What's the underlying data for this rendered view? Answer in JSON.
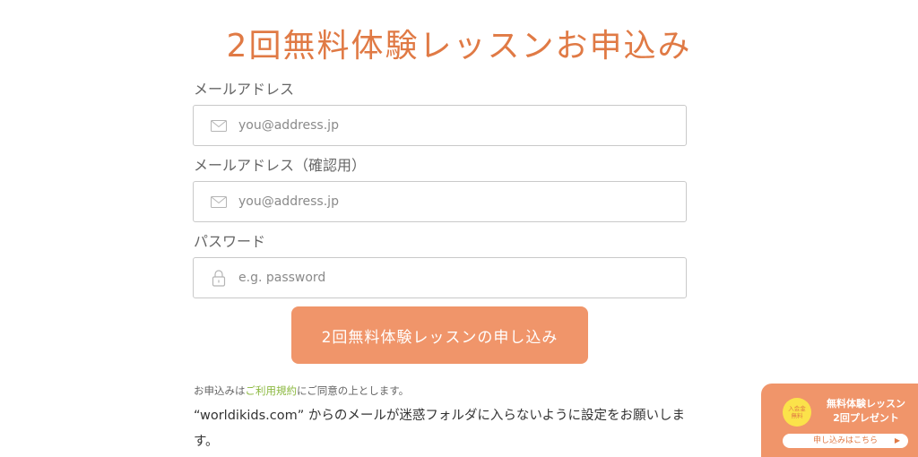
{
  "title": "2回無料体験レッスンお申込み",
  "form": {
    "email_label": "メールアドレス",
    "email_placeholder": "you@address.jp",
    "email_confirm_label": "メールアドレス（確認用）",
    "email_confirm_placeholder": "you@address.jp",
    "password_label": "パスワード",
    "password_placeholder": "e.g. password",
    "submit_label": "2回無料体験レッスンの申し込み"
  },
  "terms": {
    "prefix": "お申込みは",
    "link": "ご利用規約",
    "suffix": "にご同意の上とします。"
  },
  "notice": "“worldikids.com” からのメールが迷惑フォルダに入らないように設定をお願いします。",
  "promo": {
    "badge_line1": "入会金",
    "badge_line2": "無料",
    "text_line1": "無料体験レッスン",
    "text_line2": "2回プレゼント",
    "button_label": "申し込みはこちら",
    "button_arrow": "▶"
  },
  "colors": {
    "accent": "#e07a45",
    "button": "#f0956a",
    "link": "#8bb83f",
    "badge": "#fbe24a"
  },
  "icons": {
    "email": "mail-icon",
    "password": "lock-icon"
  }
}
